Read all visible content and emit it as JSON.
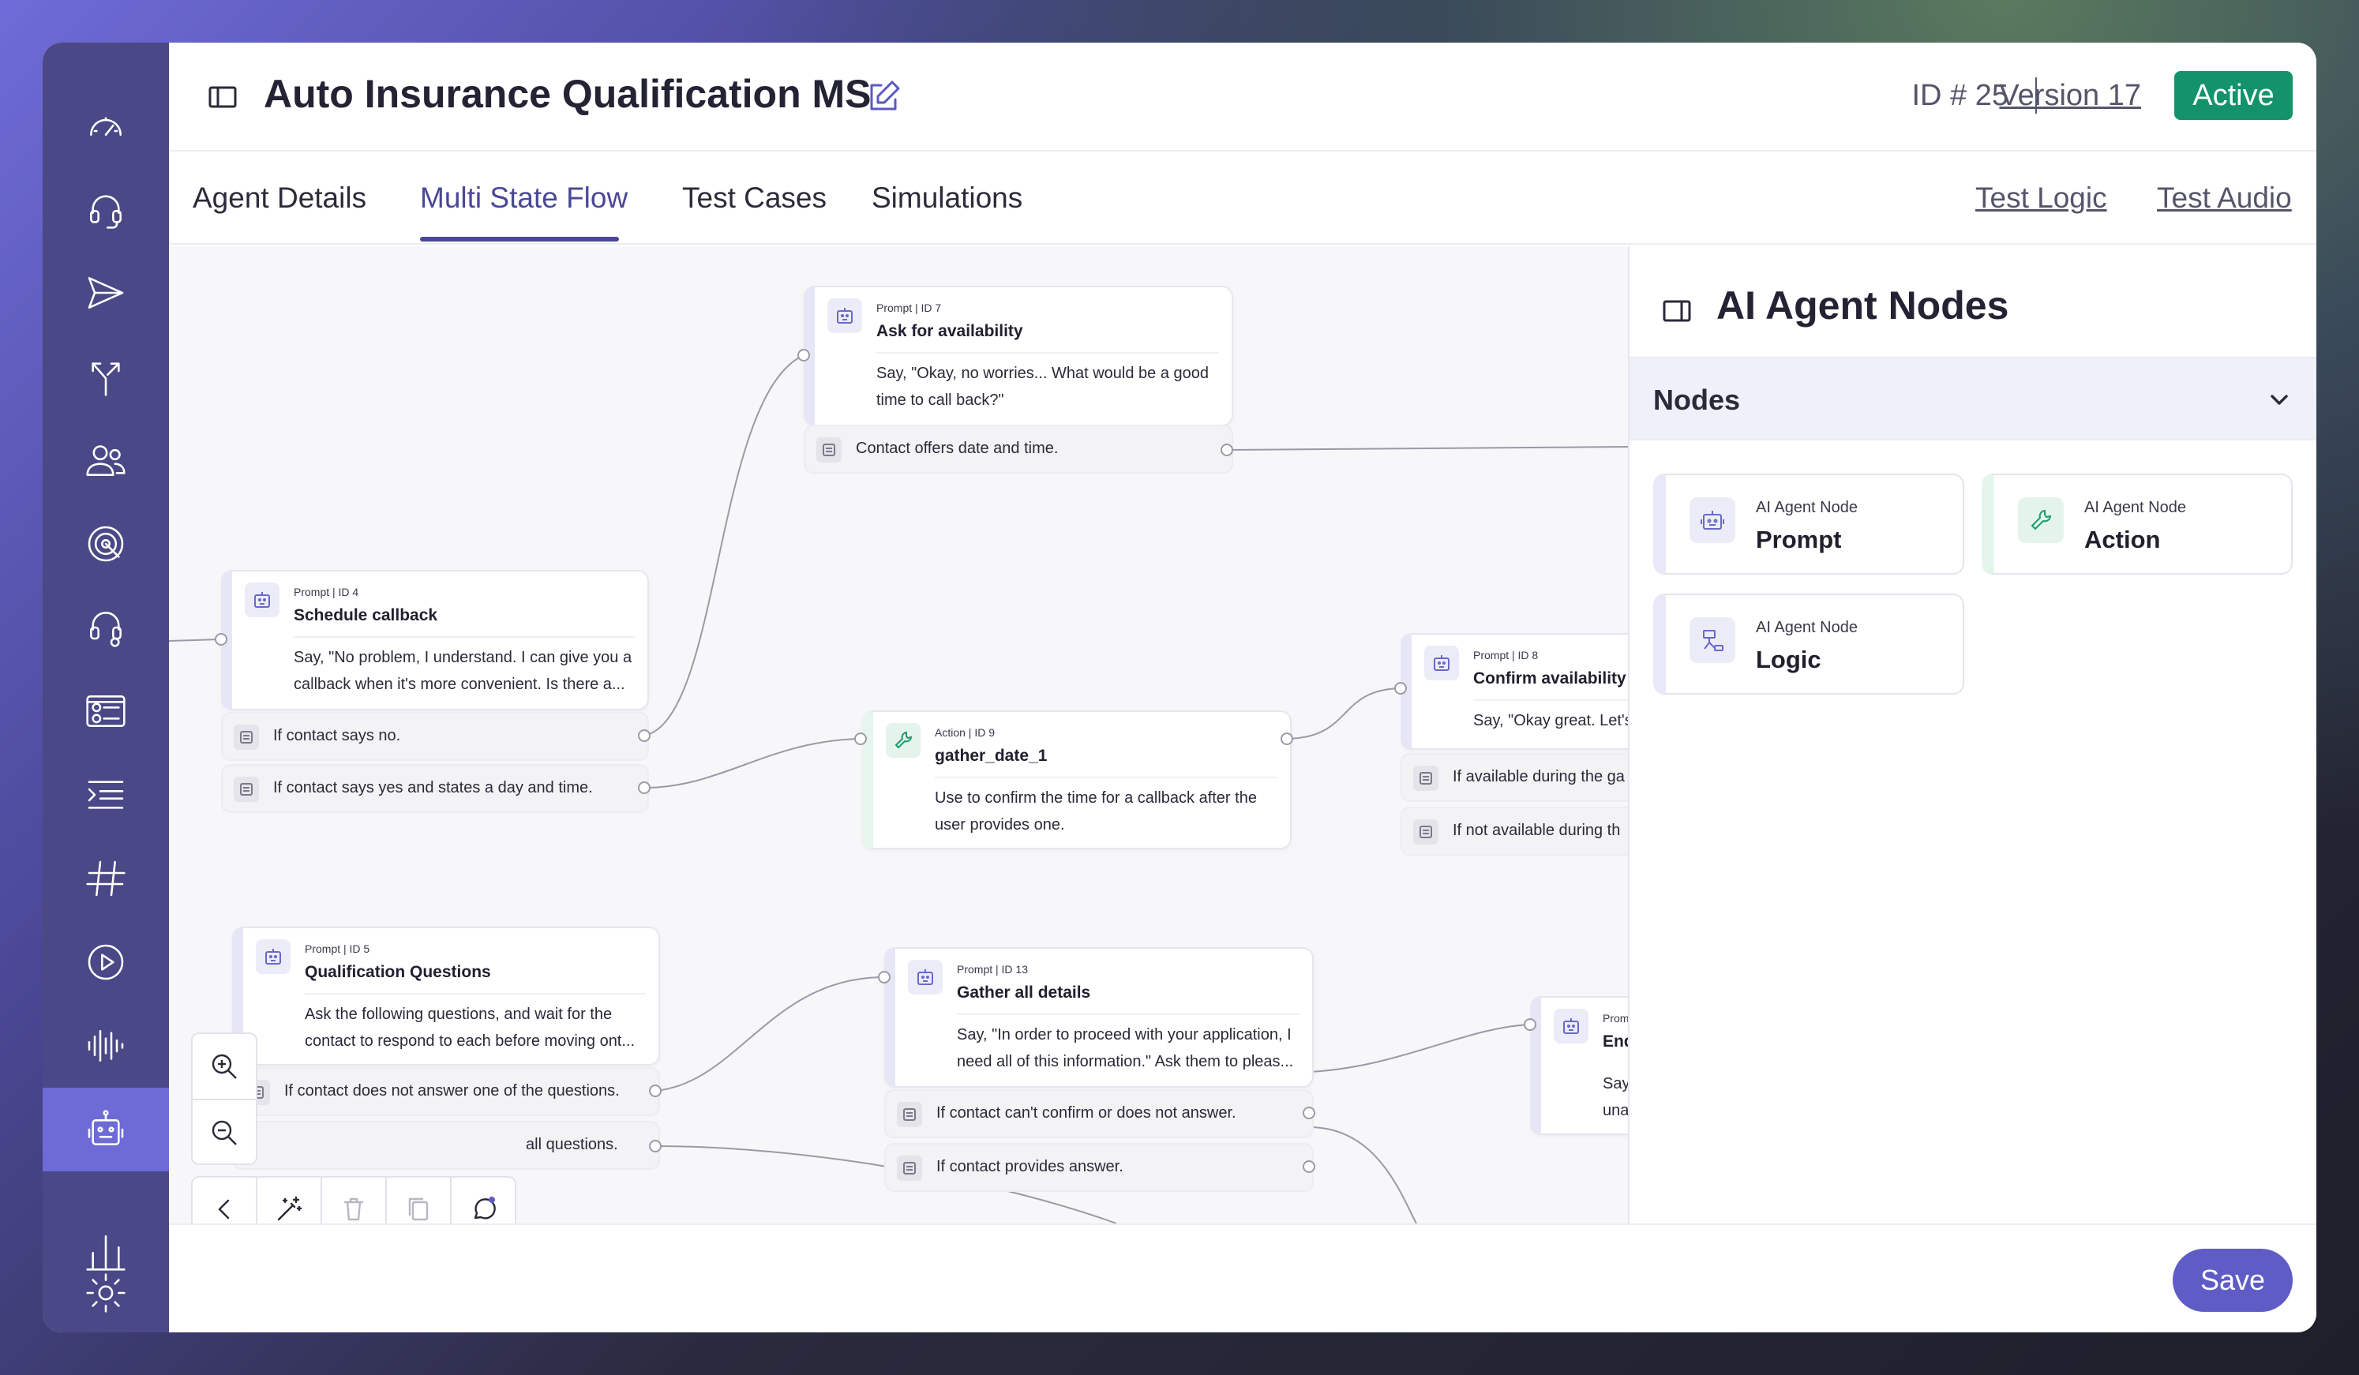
{
  "header": {
    "title": "Auto Insurance Qualification MS",
    "id_label": "ID # 25",
    "version": "Version 17",
    "status": "Active"
  },
  "tabs": [
    {
      "label": "Agent Details"
    },
    {
      "label": "Multi State Flow"
    },
    {
      "label": "Test Cases"
    },
    {
      "label": "Simulations"
    }
  ],
  "tab_links": [
    {
      "label": "Test Logic"
    },
    {
      "label": "Test Audio"
    }
  ],
  "active_tab": "Multi State Flow",
  "rail": {
    "icons": [
      "dashboard-icon",
      "headset-icon",
      "send-icon",
      "split-icon",
      "users-icon",
      "target-icon",
      "support-icon",
      "id-card-icon",
      "list-icon",
      "hash-icon",
      "play-icon",
      "audio-wave-icon",
      "robot-icon",
      "bar-chart-icon",
      "settings-icon"
    ],
    "active": "robot-icon"
  },
  "flow": {
    "nodes": [
      {
        "meta": "Prompt | ID 7",
        "title": "Ask for availability",
        "body": "Say, \"Okay, no worries... What would be a good time to call back?\"",
        "conditions": [
          "Contact offers date and time."
        ]
      },
      {
        "meta": "Prompt | ID 4",
        "title": "Schedule callback",
        "body": "Say, \"No problem, I understand. I can give you a callback when it's more convenient. Is there a...",
        "conditions": [
          "If contact says no.",
          "If contact says yes and states a day and time."
        ]
      },
      {
        "meta": "Action | ID 9",
        "title": "gather_date_1",
        "body": "Use to confirm the time for a callback after the user provides one.",
        "conditions": []
      },
      {
        "meta": "Prompt | ID 8",
        "title": "Confirm availability",
        "body": "Say, \"Okay great. Let's",
        "conditions": [
          "If available during the ga",
          "If not available during th"
        ]
      },
      {
        "meta": "Prompt | ID 5",
        "title": "Qualification Questions",
        "body": "Ask the following questions, and wait for the contact to respond to each before moving ont...",
        "conditions": [
          "If contact does not answer one of the questions.",
          "all questions."
        ]
      },
      {
        "meta": "Prompt | ID 13",
        "title": "Gather all details",
        "body": "Say, \"In order to proceed with your application, I need all of this information.\" Ask them to pleas...",
        "conditions": [
          "If contact can't confirm or does not answer.",
          "If contact provides answer."
        ]
      },
      {
        "meta": "Promp",
        "title": "End",
        "body": "Say, unab",
        "conditions": []
      }
    ]
  },
  "panel": {
    "title": "AI Agent Nodes",
    "section": "Nodes",
    "palette": [
      {
        "sub": "AI Agent Node",
        "name": "Prompt",
        "icon": "robot-icon"
      },
      {
        "sub": "AI Agent Node",
        "name": "Action",
        "icon": "wrench-icon"
      },
      {
        "sub": "AI Agent Node",
        "name": "Logic",
        "icon": "logic-icon"
      }
    ]
  },
  "footer": {
    "save_label": "Save"
  },
  "colors": {
    "rail": "#4a4886",
    "rail_active": "#6e6bd6",
    "accent": "#4a4896",
    "status_badge": "#14936b",
    "save_button": "#5f5cc6"
  }
}
